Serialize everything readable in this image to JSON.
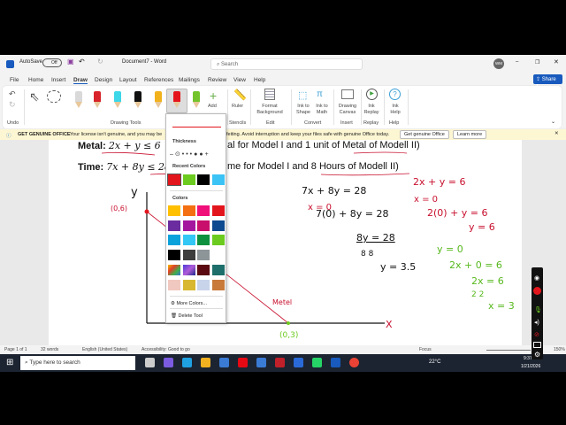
{
  "titlebar": {
    "autosave": "AutoSave",
    "autosave_state": "Off",
    "doc_title": "Document7 - Word",
    "search_placeholder": "Search",
    "avatar": "WM"
  },
  "menu": [
    "File",
    "Home",
    "Insert",
    "Draw",
    "Design",
    "Layout",
    "References",
    "Mailings",
    "Review",
    "View",
    "Help"
  ],
  "share": "Share",
  "ribbon": {
    "add": "Add",
    "ruler": "Ruler",
    "format_bg": "Format Background",
    "ink_shape": "Ink to Shape",
    "ink_math": "Ink to Math",
    "canvas": "Drawing Canvas",
    "replay": "Ink Replay",
    "help": "Ink Help",
    "groups": {
      "undo": "Undo",
      "drawing_tools": "Drawing Tools",
      "stencils": "Stencils",
      "edit": "Edit",
      "convert": "Convert",
      "insert": "Insert",
      "replay": "Replay",
      "help": "Help"
    }
  },
  "pens": [
    "#d9d9d9",
    "#d8232a",
    "#3cd7e8",
    "#111111",
    "#f2b21b",
    "#e5151d",
    "#72c32c"
  ],
  "infobar": {
    "title": "GET GENUINE OFFICE",
    "msg1": "Your license isn't genuine, and you may be",
    "msg2": "feiting. Avoid interruption and keep your files safe with genuine Office today.",
    "btn1": "Get genuine Office",
    "btn2": "Learn more"
  },
  "document": {
    "line1_label": "Metal:",
    "line1_eq": "2x + y ≤ 6",
    "line1_rest": "al for Model I and 1 unit of Metal of Modell II)",
    "line2_label": "Time:",
    "line2_eq": "7x + 8y ≤ 28",
    "line2_rest": "me for Model I and 8 Hours of Modell II)"
  },
  "ink": {
    "y_axis": "y",
    "x_axis": "X",
    "point_a": "(0,6)",
    "point_b": "(0,3)",
    "line_label": "Metel",
    "black": [
      "7x + 8y = 28",
      "7(0) + 8y = 28",
      "8y = 28",
      "8      8",
      "y = 3.5"
    ],
    "red_x0": "x = 0",
    "red": [
      "2x + y = 6",
      "x = 0",
      "2(0) + y = 6",
      "y = 6"
    ],
    "green": [
      "y = 0",
      "2x + 0 = 6",
      "2x = 6",
      "2     2",
      "x = 3"
    ]
  },
  "popup": {
    "thickness": "Thickness",
    "recent": "Recent Colors",
    "colors": "Colors",
    "more": "More Colors...",
    "delete": "Delete Tool",
    "recent_colors": [
      "#e3151c",
      "#6ccb1f",
      "#000000",
      "#3bc3f5"
    ],
    "palette": [
      "#ffc000",
      "#f36f11",
      "#f0107a",
      "#e3151c",
      "#6a2c9e",
      "#a4169e",
      "#c80f6b",
      "#0d4a8f",
      "#0ba1db",
      "#33c7f5",
      "#0e913f",
      "#6ccb1f",
      "#000000",
      "#3d3d3d",
      "#8e9599"
    ]
  },
  "status": {
    "page": "Page 1 of 1",
    "words": "32 words",
    "lang": "English (United States)",
    "access": "Accessibility: Good to go",
    "focus": "Focus",
    "zoom": "150%"
  },
  "taskbar": {
    "search": "Type here to search",
    "temp": "22°C",
    "time": "9:37",
    "date": "1/21/2026"
  }
}
